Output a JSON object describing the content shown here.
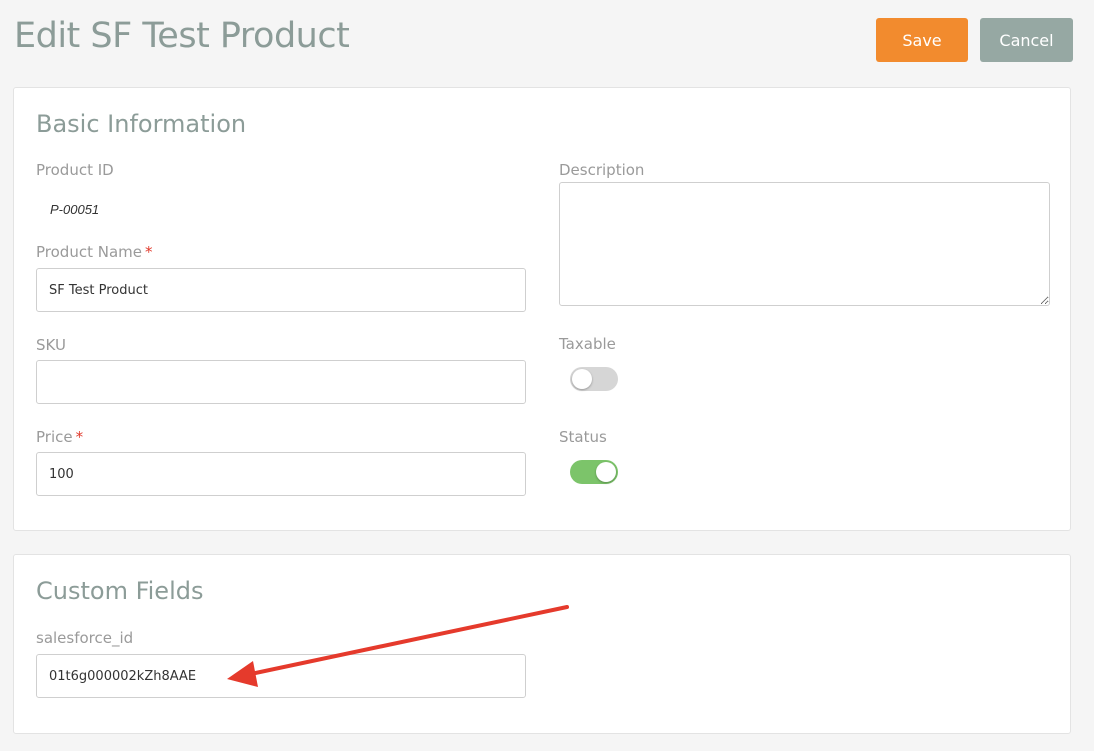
{
  "page": {
    "title": "Edit SF Test Product"
  },
  "toolbar": {
    "save_label": "Save",
    "cancel_label": "Cancel"
  },
  "basic": {
    "title": "Basic Information",
    "product_id_label": "Product ID",
    "product_id_value": "P-00051",
    "product_name_label": "Product Name",
    "product_name_value": "SF Test Product",
    "sku_label": "SKU",
    "sku_value": "",
    "price_label": "Price",
    "price_value": "100",
    "description_label": "Description",
    "description_value": "",
    "taxable_label": "Taxable",
    "taxable_on": false,
    "status_label": "Status",
    "status_on": true,
    "required_marker": "*"
  },
  "custom": {
    "title": "Custom Fields",
    "salesforce_id_label": "salesforce_id",
    "salesforce_id_value": "01t6g000002kZh8AAE"
  },
  "colors": {
    "save_button": "#f28b2e",
    "cancel_button": "#96a8a3",
    "toggle_on": "#7cc46a",
    "toggle_off": "#d6d6d6",
    "required": "#e0392b",
    "annotation_arrow": "#e53a2c"
  }
}
